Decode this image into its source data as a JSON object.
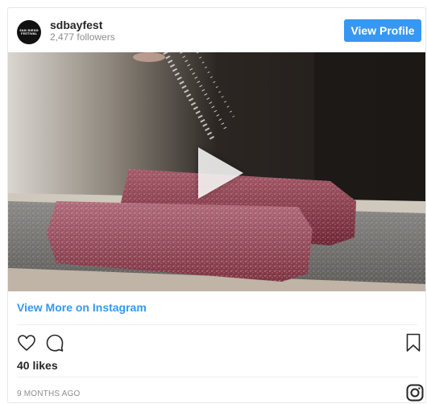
{
  "post": {
    "username": "sdbayfest",
    "followers": "2,477 followers",
    "avatar_text": [
      "SAN DIEGO",
      "FESTIVAL"
    ],
    "view_profile_label": "View Profile",
    "view_more_label": "View More on Instagram",
    "likes": "40 likes",
    "timestamp": "9 MONTHS AGO"
  },
  "colors": {
    "accent": "#3897f0",
    "muted": "#8e8e8e",
    "text": "#262626"
  },
  "icons": {
    "play": "play-icon",
    "like": "heart-icon",
    "comment": "comment-icon",
    "save": "bookmark-icon",
    "brand": "instagram-icon"
  }
}
